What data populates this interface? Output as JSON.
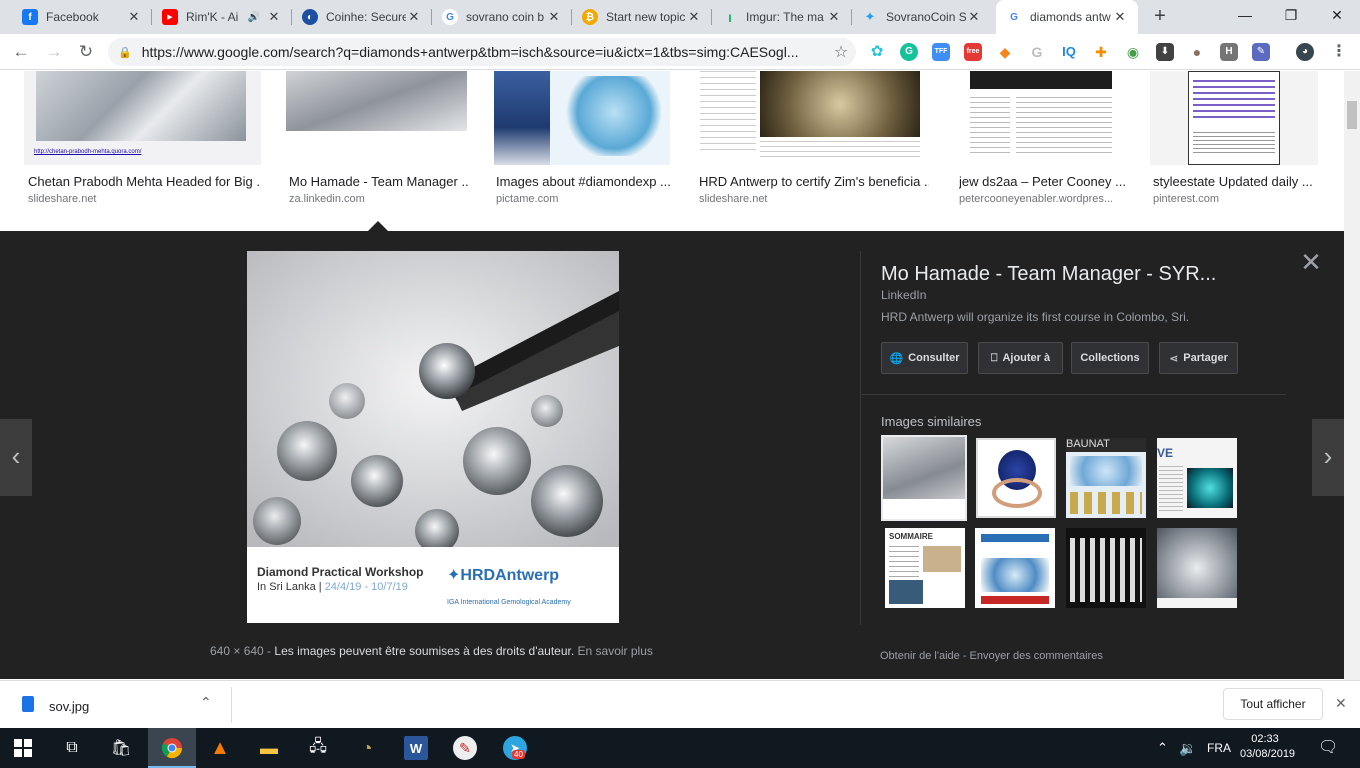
{
  "tabs": [
    {
      "title": "Facebook",
      "favicon": "facebook-icon",
      "color": "#1877f2",
      "glyph": "f"
    },
    {
      "title": "Rim'K - Ai",
      "favicon": "youtube-icon",
      "color": "#ff0000",
      "glyph": "▶",
      "audio": "🔊"
    },
    {
      "title": "Coinhe: Secure",
      "favicon": "coinhe-icon",
      "color": "#1c4fa0",
      "glyph": "◐"
    },
    {
      "title": "sovrano coin b",
      "favicon": "google-icon",
      "color": "#ffffff",
      "glyph": "G"
    },
    {
      "title": "Start new topic",
      "favicon": "bitcoin-icon",
      "color": "#f2a900",
      "glyph": "₿"
    },
    {
      "title": "Imgur: The ma",
      "favicon": "imgur-icon",
      "color": "#1bb76e",
      "glyph": "ı"
    },
    {
      "title": "SovranoCoin S",
      "favicon": "twitter-icon",
      "color": "#1da1f2",
      "glyph": "✦"
    },
    {
      "title": "diamonds antw",
      "favicon": "google-icon",
      "color": "#ffffff",
      "glyph": "G"
    }
  ],
  "close_glyph": "✕",
  "new_tab_glyph": "+",
  "window": {
    "minimize": "—",
    "maximize": "❐",
    "close": "✕"
  },
  "nav": {
    "back": "←",
    "forward": "→",
    "reload": "↻"
  },
  "address": {
    "lock": "🔒",
    "url": "https://www.google.com/search?q=diamonds+antwerp&tbm=isch&source=iu&ictx=1&tbs=simg:CAESogl...",
    "star": "☆"
  },
  "extensions": [
    {
      "name": "ext-1-icon",
      "color": "#26c6da",
      "glyph": "✿"
    },
    {
      "name": "grammarly-icon",
      "color": "#15c39a",
      "glyph": "G"
    },
    {
      "name": "ext-tff-icon",
      "color": "#3f8ef5",
      "glyph": "TFF"
    },
    {
      "name": "ext-free-icon",
      "color": "#e53935",
      "glyph": "free"
    },
    {
      "name": "metamask-icon",
      "color": "#f6851b",
      "glyph": "◆"
    },
    {
      "name": "google-ext-icon",
      "color": "#bdbdbd",
      "glyph": "G"
    },
    {
      "name": "iq-icon",
      "color": "#1e88e5",
      "glyph": "IQ"
    },
    {
      "name": "ext-8-icon",
      "color": "#fb8c00",
      "glyph": "✚"
    },
    {
      "name": "ext-9-icon",
      "color": "#43a047",
      "glyph": "◉"
    },
    {
      "name": "download-ext-icon",
      "color": "#424242",
      "glyph": "⬇"
    },
    {
      "name": "ext-11-icon",
      "color": "#8d6e63",
      "glyph": "●"
    },
    {
      "name": "ext-h-icon",
      "color": "#757575",
      "glyph": "H"
    },
    {
      "name": "ext-13-icon",
      "color": "#5c6bc0",
      "glyph": "✎"
    },
    {
      "name": "profile-avatar-icon",
      "color": "#37474f",
      "glyph": "◕"
    }
  ],
  "menu_glyph": "⋮",
  "results": [
    {
      "title": "Chetan Prabodh Mehta Headed for Big ...",
      "source": "slideshare.net",
      "url_text": "http://chetan-prabodh-mehta.quora.com/"
    },
    {
      "title": "Mo Hamade - Team Manager ...",
      "source": "za.linkedin.com"
    },
    {
      "title": "Images about #diamondexp ...",
      "source": "pictame.com"
    },
    {
      "title": "HRD Antwerp to certify Zim's beneficia ...",
      "source": "slideshare.net"
    },
    {
      "title": "jew ds2aa – Peter Cooney ...",
      "source": "petercooneyenabler.wordpres..."
    },
    {
      "title": "styleestate Updated daily ...",
      "source": "pinterest.com"
    }
  ],
  "preview": {
    "title": "Mo Hamade - Team Manager - SYR...",
    "site": "LinkedIn",
    "description": "HRD Antwerp will organize its first course in Colombo, Sri.",
    "buttons": [
      {
        "label": "Consulter",
        "icon": "globe-icon",
        "glyph": "🌐"
      },
      {
        "label": "Ajouter à",
        "icon": "bookmark-icon",
        "glyph": "⎕"
      },
      {
        "label": "Collections",
        "icon": "",
        "glyph": ""
      },
      {
        "label": "Partager",
        "icon": "share-icon",
        "glyph": "⋖"
      }
    ],
    "similar_header": "Images similaires",
    "similar_label": "BAUNAT",
    "similar_count": 8,
    "size": "640 × 640",
    "copyright": "Les images peuvent être soumises à des droits d'auteur.",
    "learn_more": "En savoir plus",
    "help": "Obtenir de l'aide",
    "feedback": "Envoyer des commentaires",
    "close": "✕",
    "prev": "‹",
    "next": "›"
  },
  "image_caption": {
    "line1": "Diamond Practical Workshop",
    "line2_place": "In Sri Lanka  |",
    "line2_dates": "24/4/19 - 10/7/19",
    "brand": "✦HRDAntwerp",
    "iga": "IGA  International Gemological Academy"
  },
  "download": {
    "filename": "sov.jpg",
    "chevron": "⌃",
    "show_all": "Tout afficher",
    "close": "✕"
  },
  "taskbar": {
    "lang": "FRA",
    "time": "02:33",
    "date": "03/08/2019",
    "badge": "40",
    "tray_up": "⌃",
    "speaker": "🔉",
    "notif": "🗨"
  }
}
